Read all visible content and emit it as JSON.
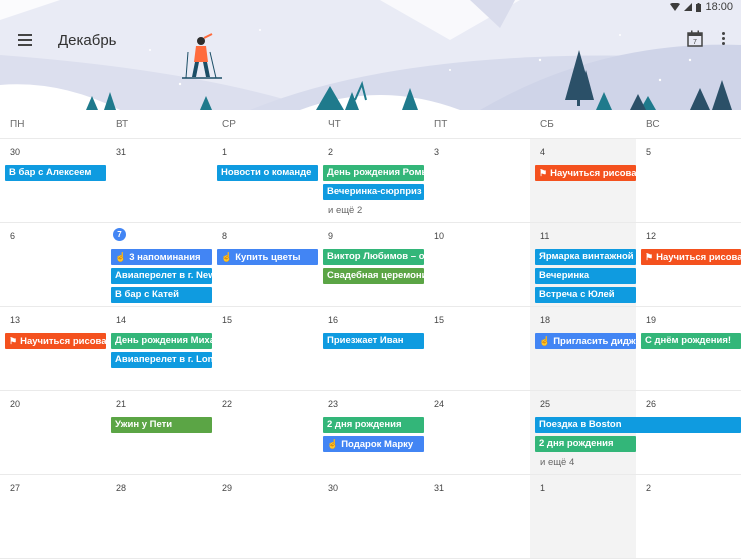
{
  "status_bar": {
    "time": "18:00"
  },
  "header": {
    "month_title": "Декабрь",
    "calendar_icon_day": "7"
  },
  "weekdays": [
    "ПН",
    "ВТ",
    "СР",
    "ЧТ",
    "ПТ",
    "СБ",
    "ВС"
  ],
  "colors": {
    "blue": "#0f9be0",
    "green": "#33b679",
    "orange": "#f4511e",
    "royal": "#4285f4",
    "olive": "#5ba545"
  },
  "weeks": [
    {
      "days": [
        "30",
        "31",
        "1",
        "2",
        "3",
        "4",
        "5"
      ],
      "events": [
        {
          "title": "В бар с Алексеем",
          "day": 0,
          "span": 1,
          "slot": 0,
          "color": "blue"
        },
        {
          "title": "Новости о команде",
          "day": 2,
          "span": 1,
          "slot": 0,
          "color": "blue"
        },
        {
          "title": "День рождения Ромы",
          "day": 3,
          "span": 1,
          "slot": 0,
          "color": "green"
        },
        {
          "title": "Вечеринка-сюрприз",
          "day": 3,
          "span": 1,
          "slot": 1,
          "color": "blue"
        },
        {
          "title": "Научиться рисовать",
          "day": 5,
          "span": 1,
          "slot": 0,
          "color": "orange",
          "icon": "flag"
        }
      ],
      "more": [
        {
          "day": 3,
          "slot": 2,
          "label": "и ещё 2"
        }
      ]
    },
    {
      "days": [
        "6",
        "7",
        "8",
        "9",
        "10",
        "11",
        "12"
      ],
      "today": 1,
      "events": [
        {
          "title": "3 напоминания",
          "day": 1,
          "span": 1,
          "slot": 0,
          "color": "royal",
          "icon": "hand"
        },
        {
          "title": "Авиаперелет в г. New York",
          "day": 1,
          "span": 1,
          "slot": 1,
          "color": "blue"
        },
        {
          "title": "В бар с Катей",
          "day": 1,
          "span": 1,
          "slot": 2,
          "color": "blue"
        },
        {
          "title": "Купить цветы",
          "day": 2,
          "span": 1,
          "slot": 0,
          "color": "royal",
          "icon": "hand"
        },
        {
          "title": "Виктор Любимов – обед",
          "day": 3,
          "span": 1,
          "slot": 0,
          "color": "green"
        },
        {
          "title": "Свадебная церемония",
          "day": 3,
          "span": 1,
          "slot": 1,
          "color": "olive"
        },
        {
          "title": "Ярмарка винтажной одежды",
          "day": 5,
          "span": 1,
          "slot": 0,
          "color": "blue"
        },
        {
          "title": "Вечеринка",
          "day": 5,
          "span": 1,
          "slot": 1,
          "color": "blue"
        },
        {
          "title": "Встреча с Юлей",
          "day": 5,
          "span": 1,
          "slot": 2,
          "color": "blue"
        },
        {
          "title": "Научиться рисовать",
          "day": 6,
          "span": 1,
          "slot": 0,
          "color": "orange",
          "icon": "flag"
        }
      ],
      "more": []
    },
    {
      "days": [
        "13",
        "14",
        "15",
        "16",
        "15",
        "18",
        "19"
      ],
      "events": [
        {
          "title": "Научиться рисовать",
          "day": 0,
          "span": 1,
          "slot": 0,
          "color": "orange",
          "icon": "flag"
        },
        {
          "title": "День рождения Михаила",
          "day": 1,
          "span": 1,
          "slot": 0,
          "color": "green"
        },
        {
          "title": "Авиаперелет в г. London",
          "day": 1,
          "span": 1,
          "slot": 1,
          "color": "blue"
        },
        {
          "title": "Приезжает Иван",
          "day": 3,
          "span": 1,
          "slot": 0,
          "color": "blue"
        },
        {
          "title": "Пригласить диджея",
          "day": 5,
          "span": 1,
          "slot": 0,
          "color": "royal",
          "icon": "hand"
        },
        {
          "title": "С днём рождения!",
          "day": 6,
          "span": 1,
          "slot": 0,
          "color": "green"
        }
      ],
      "more": []
    },
    {
      "days": [
        "20",
        "21",
        "22",
        "23",
        "24",
        "25",
        "26"
      ],
      "events": [
        {
          "title": "Ужин у Пети",
          "day": 1,
          "span": 1,
          "slot": 0,
          "color": "olive"
        },
        {
          "title": "2 дня рождения",
          "day": 3,
          "span": 1,
          "slot": 0,
          "color": "green"
        },
        {
          "title": "Подарок Марку",
          "day": 3,
          "span": 1,
          "slot": 1,
          "color": "royal",
          "icon": "hand"
        },
        {
          "title": "Поездка в Boston",
          "day": 5,
          "span": 2,
          "slot": 0,
          "color": "blue"
        },
        {
          "title": "2 дня рождения",
          "day": 5,
          "span": 1,
          "slot": 1,
          "color": "green"
        }
      ],
      "more": [
        {
          "day": 5,
          "slot": 2,
          "label": "и ещё 4"
        }
      ]
    },
    {
      "days": [
        "27",
        "28",
        "29",
        "30",
        "31",
        "1",
        "2"
      ],
      "events": [],
      "more": []
    }
  ]
}
